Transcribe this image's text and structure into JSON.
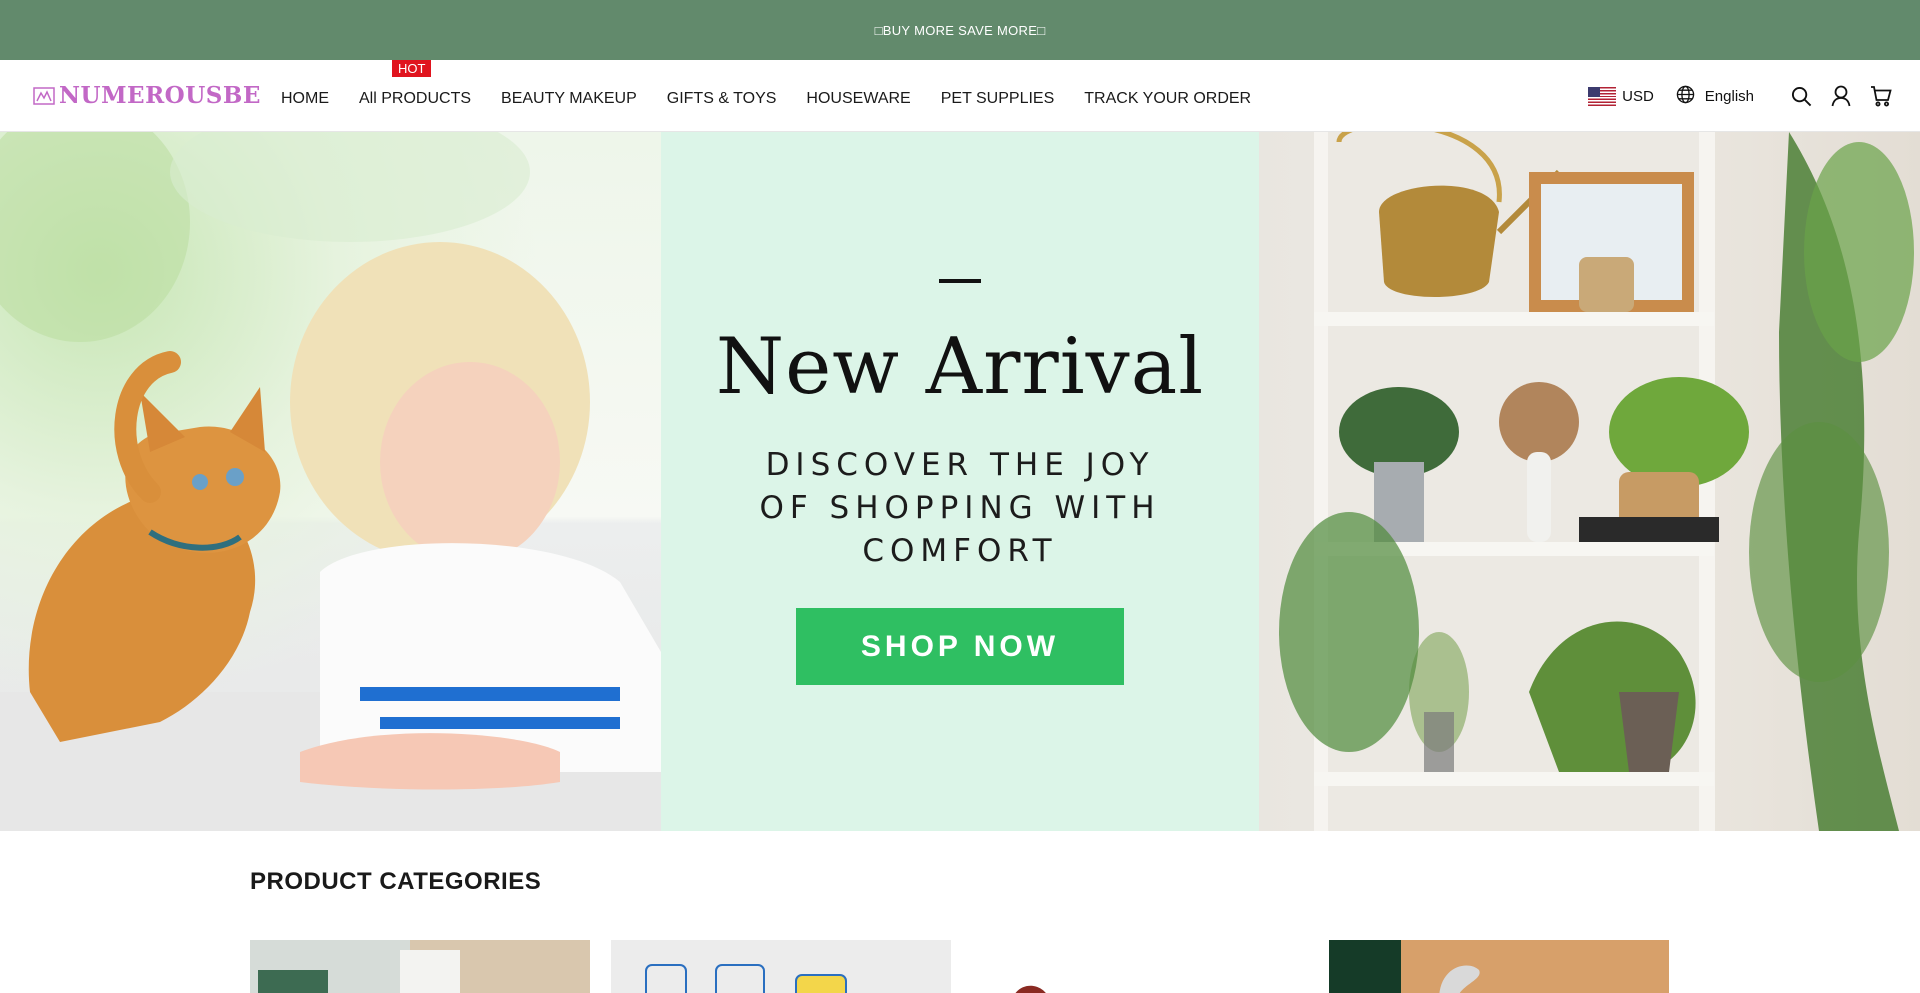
{
  "announcement": "□BUY MORE SAVE MORE□",
  "brand": {
    "name": "NUMEROUSBE",
    "color": "#c268c6"
  },
  "nav": {
    "items": [
      {
        "label": "HOME"
      },
      {
        "label": "All PRODUCTS",
        "badge": "HOT"
      },
      {
        "label": "BEAUTY MAKEUP"
      },
      {
        "label": "GIFTS & TOYS"
      },
      {
        "label": "HOUSEWARE"
      },
      {
        "label": "PET SUPPLIES"
      },
      {
        "label": "TRACK YOUR ORDER"
      }
    ]
  },
  "header": {
    "currency": "USD",
    "language": "English",
    "icons": [
      "us-flag-icon",
      "globe-icon",
      "search-icon",
      "account-icon",
      "cart-icon"
    ]
  },
  "hero": {
    "title": "New Arrival",
    "subtitle_lines": [
      "DISCOVER THE JOY",
      "OF SHOPPING WITH",
      "COMFORT"
    ],
    "cta": "SHOP NOW",
    "cta_color": "#2fbf62",
    "panel_color": "#dcf5e8"
  },
  "categories": {
    "title": "PRODUCT CATEGORIES",
    "cards": 4
  },
  "colors": {
    "announcement_bg": "#628a6c",
    "hot_badge": "#e0141e"
  }
}
